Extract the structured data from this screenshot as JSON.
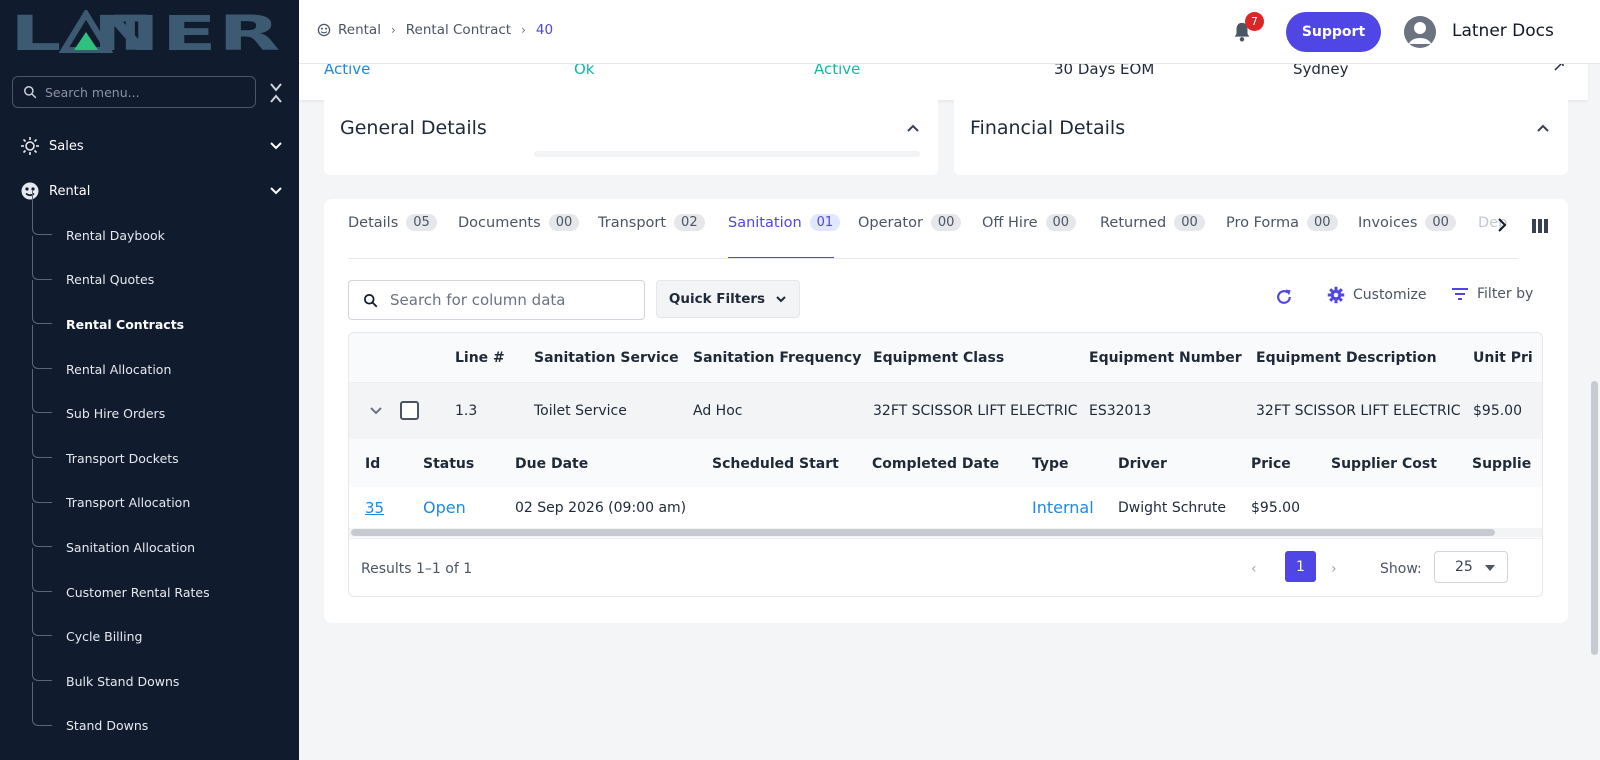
{
  "brand": {
    "logo_text": "LATNER",
    "logo_color": "#3d5a73",
    "accent": "#2ec27e"
  },
  "colors": {
    "primary": "#4f46e5",
    "link": "#1e88e5",
    "status_green": "#14b8a6",
    "sidebar_bg": "#111b2e",
    "danger": "#dc2626"
  },
  "sidebar": {
    "search_placeholder": "Search menu...",
    "groups": [
      {
        "label": "Sales",
        "icon": "sales-icon"
      },
      {
        "label": "Rental",
        "icon": "rental-icon"
      }
    ],
    "items": [
      {
        "label": "Rental Daybook"
      },
      {
        "label": "Rental Quotes"
      },
      {
        "label": "Rental Contracts",
        "active": true
      },
      {
        "label": "Rental Allocation"
      },
      {
        "label": "Sub Hire Orders"
      },
      {
        "label": "Transport Dockets"
      },
      {
        "label": "Transport Allocation"
      },
      {
        "label": "Sanitation Allocation"
      },
      {
        "label": "Customer Rental Rates"
      },
      {
        "label": "Cycle Billing"
      },
      {
        "label": "Bulk Stand Downs"
      },
      {
        "label": "Stand Downs"
      }
    ]
  },
  "header": {
    "breadcrumb": [
      "Rental",
      "Rental Contract",
      "40"
    ],
    "notifications": "7",
    "support_label": "Support",
    "user_name": "Latner Docs"
  },
  "status_strip": [
    "Active",
    "Ok",
    "Active",
    "30 Days EOM",
    "Sydney"
  ],
  "panels": {
    "general": "General Details",
    "financial": "Financial Details"
  },
  "tabs": [
    {
      "label": "Details",
      "count": "05"
    },
    {
      "label": "Documents",
      "count": "00"
    },
    {
      "label": "Transport",
      "count": "02"
    },
    {
      "label": "Sanitation",
      "count": "01",
      "active": true
    },
    {
      "label": "Operator",
      "count": "00"
    },
    {
      "label": "Off Hire",
      "count": "00"
    },
    {
      "label": "Returned",
      "count": "00"
    },
    {
      "label": "Pro Forma",
      "count": "00"
    },
    {
      "label": "Invoices",
      "count": "00"
    },
    {
      "label": "Dep",
      "count": ""
    }
  ],
  "toolbar": {
    "search_placeholder": "Search for column data",
    "quick_filters": "Quick Filters",
    "customize": "Customize",
    "filter_by": "Filter by"
  },
  "grid": {
    "columns": [
      "Line #",
      "Sanitation Service",
      "Sanitation Frequency",
      "Equipment Class",
      "Equipment Number",
      "Equipment Description",
      "Unit Pri"
    ],
    "row": [
      "1.3",
      "Toilet Service",
      "Ad Hoc",
      "32FT SCISSOR LIFT ELECTRIC",
      "ES32013",
      "32FT SCISSOR LIFT ELECTRIC",
      "$95.00"
    ],
    "sub_columns": [
      "Id",
      "Status",
      "Due Date",
      "Scheduled Start",
      "Completed Date",
      "Type",
      "Driver",
      "Price",
      "Supplier Cost",
      "Supplie"
    ],
    "sub_row": {
      "id": "35",
      "status": "Open",
      "due_date": "02 Sep 2026 (09:00 am)",
      "scheduled_start": "",
      "completed_date": "",
      "type": "Internal",
      "driver": "Dwight Schrute",
      "price": "$95.00",
      "supplier_cost": "",
      "supplier": ""
    }
  },
  "pagination": {
    "results": "Results 1–1 of 1",
    "current_page": "1",
    "show_label": "Show:",
    "page_size": "25"
  }
}
